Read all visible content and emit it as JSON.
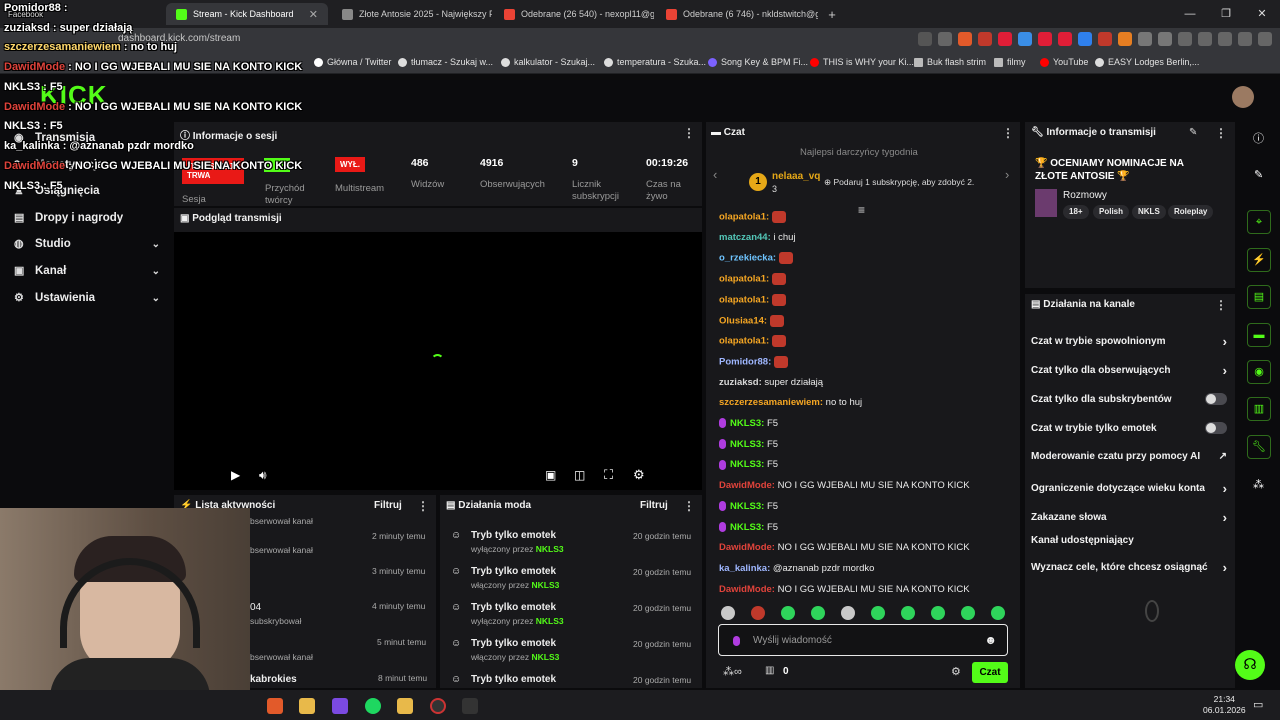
{
  "browser": {
    "tabs": [
      {
        "label": "Stream - Kick Dashboard",
        "active": true
      },
      {
        "label": "Złote Antosie 2025 - Największy Pleb"
      },
      {
        "label": "Odebrane (26 540) - nexopl11@gmail"
      },
      {
        "label": "Odebrane (6 746) - nkldstwitch@gm"
      }
    ],
    "new_tab": "+",
    "url": "dashboard.kick.com/stream",
    "bookmarks": [
      "Główna / Twitter",
      "tłumacz - Szukaj w...",
      "kalkulator - Szukaj...",
      "temperatura - Szuka...",
      "Song Key & BPM Fi...",
      "THIS is WHY your Ki...",
      "Buk flash strim",
      "filmy",
      "YouTube",
      "EASY Lodges Berlin,..."
    ]
  },
  "overlay": {
    "lines": [
      {
        "user": "Pomidor88",
        "text": " :"
      },
      {
        "user": "zuziaksd",
        "text": " : super działają"
      },
      {
        "user": "szczerzesamaniewiem",
        "text": " : no to huj"
      },
      {
        "user": "DawidMode",
        "text": " : NO I GG WJEBALI MU SIE NA KONTO KICK"
      },
      {
        "user": "NKLS3",
        "text": " : F5"
      },
      {
        "user": "DawidMode",
        "text": " : NO I GG WJEBALI MU SIE NA KONTO KICK"
      },
      {
        "user": "NKLS3",
        "text": " : F5"
      },
      {
        "user": "ka_kalinka",
        "text": " : @aznanab pzdr mordko"
      },
      {
        "user": "DawidMode",
        "text": " : NO I GG WJEBALI MU SIE NA KONTO KICK"
      },
      {
        "user": "NKLS3",
        "text": " : F5"
      }
    ],
    "facebook": "Facebook"
  },
  "sidebar": {
    "items": [
      {
        "label": "Transmisja"
      },
      {
        "label": "Monetyzacja"
      },
      {
        "label": "Osiągnięcia"
      },
      {
        "label": "Dropy i nagrody"
      },
      {
        "label": "Studio",
        "expand": true
      },
      {
        "label": "Kanał",
        "expand": true
      },
      {
        "label": "Ustawienia",
        "expand": true
      }
    ]
  },
  "session": {
    "title": "Informacje o sesji",
    "live_badge": "TRANSMISJA TRWA",
    "off_badge": "WYŁ.",
    "labels": {
      "session": "Sesja",
      "recording": "Przychód twórcy",
      "multistream": "Multistream"
    },
    "stats": [
      {
        "value": "486",
        "label": "Widzów"
      },
      {
        "value": "4916",
        "label": "Obserwujących"
      },
      {
        "value": "9",
        "label": "Licznik subskrypcji"
      },
      {
        "value": "00:19:26",
        "label": "Czas na żywo"
      }
    ]
  },
  "preview": {
    "title": "Podgląd transmisji"
  },
  "activity": {
    "title": "Lista aktywności",
    "filter": "Filtruj",
    "rows": [
      {
        "text": "",
        "sub": "bserwował kanał",
        "time": "2 minuty temu"
      },
      {
        "text": "",
        "sub": "bserwował kanał",
        "time": "3 minuty temu"
      },
      {
        "text": "04",
        "sub": "subskrybował",
        "time": "4 minuty temu"
      },
      {
        "text": "",
        "sub": "bserwował kanał",
        "time": "5 minut temu"
      },
      {
        "text": "kabrokies",
        "sub": "",
        "time": "8 minut temu"
      }
    ]
  },
  "mod": {
    "title": "Działania moda",
    "filter": "Filtruj",
    "rows": [
      {
        "title": "Tryb tylko emotek",
        "by": "wyłączony przez",
        "user": "NKLS3",
        "time": "20 godzin temu"
      },
      {
        "title": "Tryb tylko emotek",
        "by": "włączony przez",
        "user": "NKLS3",
        "time": "20 godzin temu"
      },
      {
        "title": "Tryb tylko emotek",
        "by": "wyłączony przez",
        "user": "NKLS3",
        "time": "20 godzin temu"
      },
      {
        "title": "Tryb tylko emotek",
        "by": "włączony przez",
        "user": "NKLS3",
        "time": "20 godzin temu"
      },
      {
        "title": "Tryb tylko emotek",
        "by": "",
        "user": "",
        "time": "20 godzin temu"
      }
    ]
  },
  "chat": {
    "title": "Czat",
    "top_gifter_label": "Najlepsi darczyńcy tygodnia",
    "gifter_name": "nelaaa_vq",
    "gifter_count": "3",
    "gift_prompt": "Podaruj 1 subskrypcję, aby zdobyć 2.",
    "messages": [
      {
        "user": "olapatola1:",
        "color": "#f5a623",
        "text": "",
        "emote": true
      },
      {
        "user": "matczan44:",
        "color": "#53c7b8",
        "text": " i chuj",
        "emote": false
      },
      {
        "user": "o_rzekiecka:",
        "color": "#6ec4ff",
        "text": "",
        "emote": true
      },
      {
        "user": "olapatola1:",
        "color": "#f5a623",
        "text": "",
        "emote": true
      },
      {
        "user": "olapatola1:",
        "color": "#f5a623",
        "text": "",
        "emote": true
      },
      {
        "user": "Olusiaa14:",
        "color": "#f5a623",
        "text": "",
        "emote": true
      },
      {
        "user": "olapatola1:",
        "color": "#f5a623",
        "text": "",
        "emote": true
      },
      {
        "user": "Pomidor88:",
        "color": "#9fb7ff",
        "text": "",
        "emote": true
      },
      {
        "user": "zuziaksd:",
        "color": "#d9d9d9",
        "text": " super działają",
        "emote": false
      },
      {
        "user": "szczerzesamaniewiem:",
        "color": "#f5a623",
        "text": " no to huj",
        "emote": false
      },
      {
        "user": "NKLS3:",
        "color": "#53fc18",
        "text": " F5",
        "emote": false,
        "mic": true
      },
      {
        "user": "NKLS3:",
        "color": "#53fc18",
        "text": " F5",
        "emote": false,
        "mic": true
      },
      {
        "user": "NKLS3:",
        "color": "#53fc18",
        "text": " F5",
        "emote": false,
        "mic": true
      },
      {
        "user": "DawidMode:",
        "color": "#e0433b",
        "text": " NO I GG WJEBALI MU SIE NA KONTO KICK",
        "emote": false
      },
      {
        "user": "NKLS3:",
        "color": "#53fc18",
        "text": " F5",
        "emote": false,
        "mic": true
      },
      {
        "user": "NKLS3:",
        "color": "#53fc18",
        "text": " F5",
        "emote": false,
        "mic": true
      },
      {
        "user": "DawidMode:",
        "color": "#e0433b",
        "text": " NO I GG WJEBALI MU SIE NA KONTO KICK",
        "emote": false
      },
      {
        "user": "ka_kalinka:",
        "color": "#9fb7ff",
        "text": " @aznanab pzdr mordko",
        "emote": false
      },
      {
        "user": "DawidMode:",
        "color": "#e0433b",
        "text": " NO I GG WJEBALI MU SIE NA KONTO KICK",
        "emote": false
      }
    ],
    "input_placeholder": "Wyślij wiadomość",
    "points": "0",
    "send": "Czat"
  },
  "stream_info": {
    "title": "Informacje o transmisji",
    "stream_title": "🏆 OCENIAMY NOMINACJE NA ZŁOTE ANTOSIE 🏆",
    "category": "Rozmowy",
    "tags": [
      "18+",
      "Polish",
      "NKLS",
      "Roleplay"
    ]
  },
  "channel_actions": {
    "title": "Działania na kanale",
    "rows": [
      {
        "label": "Czat w trybie spowolnionym",
        "kind": "arrow"
      },
      {
        "label": "Czat tylko dla obserwujących",
        "kind": "arrow"
      },
      {
        "label": "Czat tylko dla subskrybentów",
        "kind": "toggle"
      },
      {
        "label": "Czat w trybie tylko emotek",
        "kind": "toggle"
      },
      {
        "label": "Moderowanie czatu przy pomocy AI",
        "kind": "ext"
      },
      {
        "label": "Ograniczenie dotyczące wieku konta",
        "kind": "arrow"
      },
      {
        "label": "Zakazane słowa",
        "kind": "arrow"
      },
      {
        "label": "Kanał udostępniający",
        "kind": "none"
      },
      {
        "label": "Wyznacz cele, które chcesz osiągnąć",
        "kind": "arrow"
      }
    ]
  },
  "taskbar": {
    "time": "21:34",
    "date": "06.01.2026"
  },
  "colors": {
    "accent": "#53fc18",
    "live": "#e91916",
    "panel": "#18181b"
  }
}
